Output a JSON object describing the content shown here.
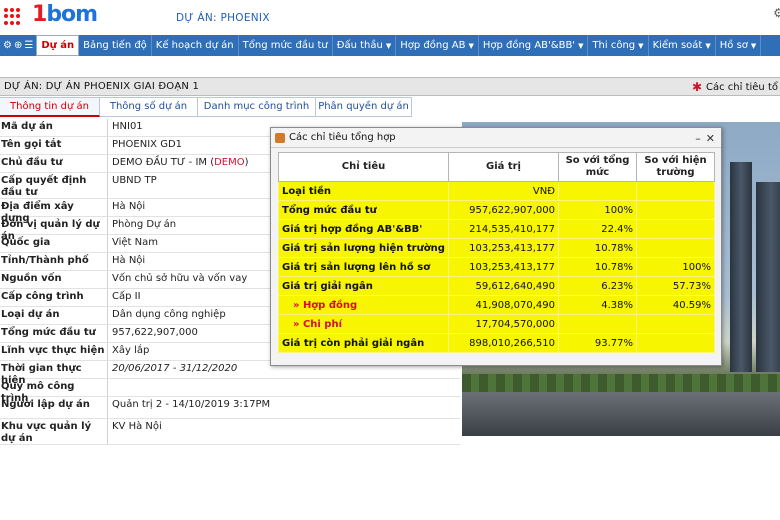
{
  "header": {
    "logo_text": "bom",
    "project_label": "DỰ ÁN: PHOENIX"
  },
  "menu": {
    "items": [
      {
        "label": "Dự án",
        "caret": false,
        "active": true
      },
      {
        "label": "Bảng tiến độ",
        "caret": false
      },
      {
        "label": "Kế hoạch dự án",
        "caret": false
      },
      {
        "label": "Tổng mức đầu tư",
        "caret": false
      },
      {
        "label": "Đấu thầu",
        "caret": true
      },
      {
        "label": "Hợp đồng AB",
        "caret": true
      },
      {
        "label": "Hợp đồng AB'&BB'",
        "caret": true
      },
      {
        "label": "Thi công",
        "caret": true
      },
      {
        "label": "Kiểm soát",
        "caret": true
      },
      {
        "label": "Hồ sơ",
        "caret": true
      }
    ]
  },
  "section": {
    "title": "DỰ ÁN: DỰ ÁN PHOENIX GIAI ĐOẠN 1",
    "summary_link": "Các chỉ tiêu tổ"
  },
  "tabs": [
    {
      "label": "Thông tin dự án",
      "active": true
    },
    {
      "label": "Thông số dự án"
    },
    {
      "label": "Danh mục công trình"
    },
    {
      "label": "Phân quyền dự án"
    }
  ],
  "info_rows": [
    {
      "key": "Mã dự án",
      "value": "HNI01"
    },
    {
      "key": "Tên gọi tắt",
      "value": "PHOENIX GD1"
    },
    {
      "key": "Chủ đầu tư",
      "value": "DEMO ĐẦU TƯ - IM",
      "value_red": "DEMO"
    },
    {
      "key": "Cấp quyết định đầu tư",
      "value": "UBND TP"
    },
    {
      "key": "Địa điểm xây dựng",
      "value": "Hà Nội"
    },
    {
      "key": "Đơn vị quản lý dự án",
      "value": "Phòng Dự án"
    },
    {
      "key": "Quốc gia",
      "value": "Việt Nam"
    },
    {
      "key": "Tỉnh/Thành phố",
      "value": "Hà Nội"
    },
    {
      "key": "Nguồn vốn",
      "value": "Vốn chủ sở hữu và vốn vay"
    },
    {
      "key": "Cấp công trình",
      "value": "Cấp II"
    },
    {
      "key": "Loại dự án",
      "value": "Dân dụng công nghiệp"
    },
    {
      "key": "Tổng mức đầu tư",
      "value": "957,622,907,000"
    },
    {
      "key": "Lĩnh vực thực hiện",
      "value": "Xây lắp"
    },
    {
      "key": "Thời gian thực hiện",
      "value": "20/06/2017 - 31/12/2020",
      "italic": true
    },
    {
      "key": "Quy mô công trình",
      "value": ""
    },
    {
      "key": "Người lập dự án",
      "value": "Quản trị 2 - 14/10/2019 3:17PM"
    },
    {
      "key": "Khu vực quản lý dự án",
      "value": "KV Hà Nội"
    }
  ],
  "popup": {
    "title": "Các chỉ tiêu tổng hợp",
    "columns": [
      "Chỉ tiêu",
      "Giá trị",
      "So với tổng mức",
      "So với hiện trường"
    ],
    "rows": [
      {
        "label": "Loại tiền",
        "value": "VNĐ",
        "pct_total": "",
        "pct_site": ""
      },
      {
        "label": "Tổng mức đầu tư",
        "value": "957,622,907,000",
        "pct_total": "100%",
        "pct_site": ""
      },
      {
        "label": "Giá trị hợp đồng AB'&BB'",
        "value": "214,535,410,177",
        "pct_total": "22.4%",
        "pct_site": ""
      },
      {
        "label": "Giá trị sản lượng hiện trường",
        "value": "103,253,413,177",
        "pct_total": "10.78%",
        "pct_site": ""
      },
      {
        "label": "Giá trị sản lượng lên hồ sơ",
        "value": "103,253,413,177",
        "pct_total": "10.78%",
        "pct_site": "100%"
      },
      {
        "label": "Giá trị giải ngân",
        "value": "59,612,640,490",
        "pct_total": "6.23%",
        "pct_site": "57.73%"
      },
      {
        "label": "» Hợp đồng",
        "value": "41,908,070,490",
        "pct_total": "4.38%",
        "pct_site": "40.59%",
        "sub": true
      },
      {
        "label": "» Chi phí",
        "value": "17,704,570,000",
        "pct_total": "",
        "pct_site": "",
        "sub": true
      },
      {
        "label": "Giá trị còn phải giải ngân",
        "value": "898,010,266,510",
        "pct_total": "93.77%",
        "pct_site": ""
      }
    ]
  },
  "colors": {
    "menu_bg": "#2f6fb8",
    "accent_red": "#d0112b",
    "highlight_yellow": "#f7f500"
  }
}
